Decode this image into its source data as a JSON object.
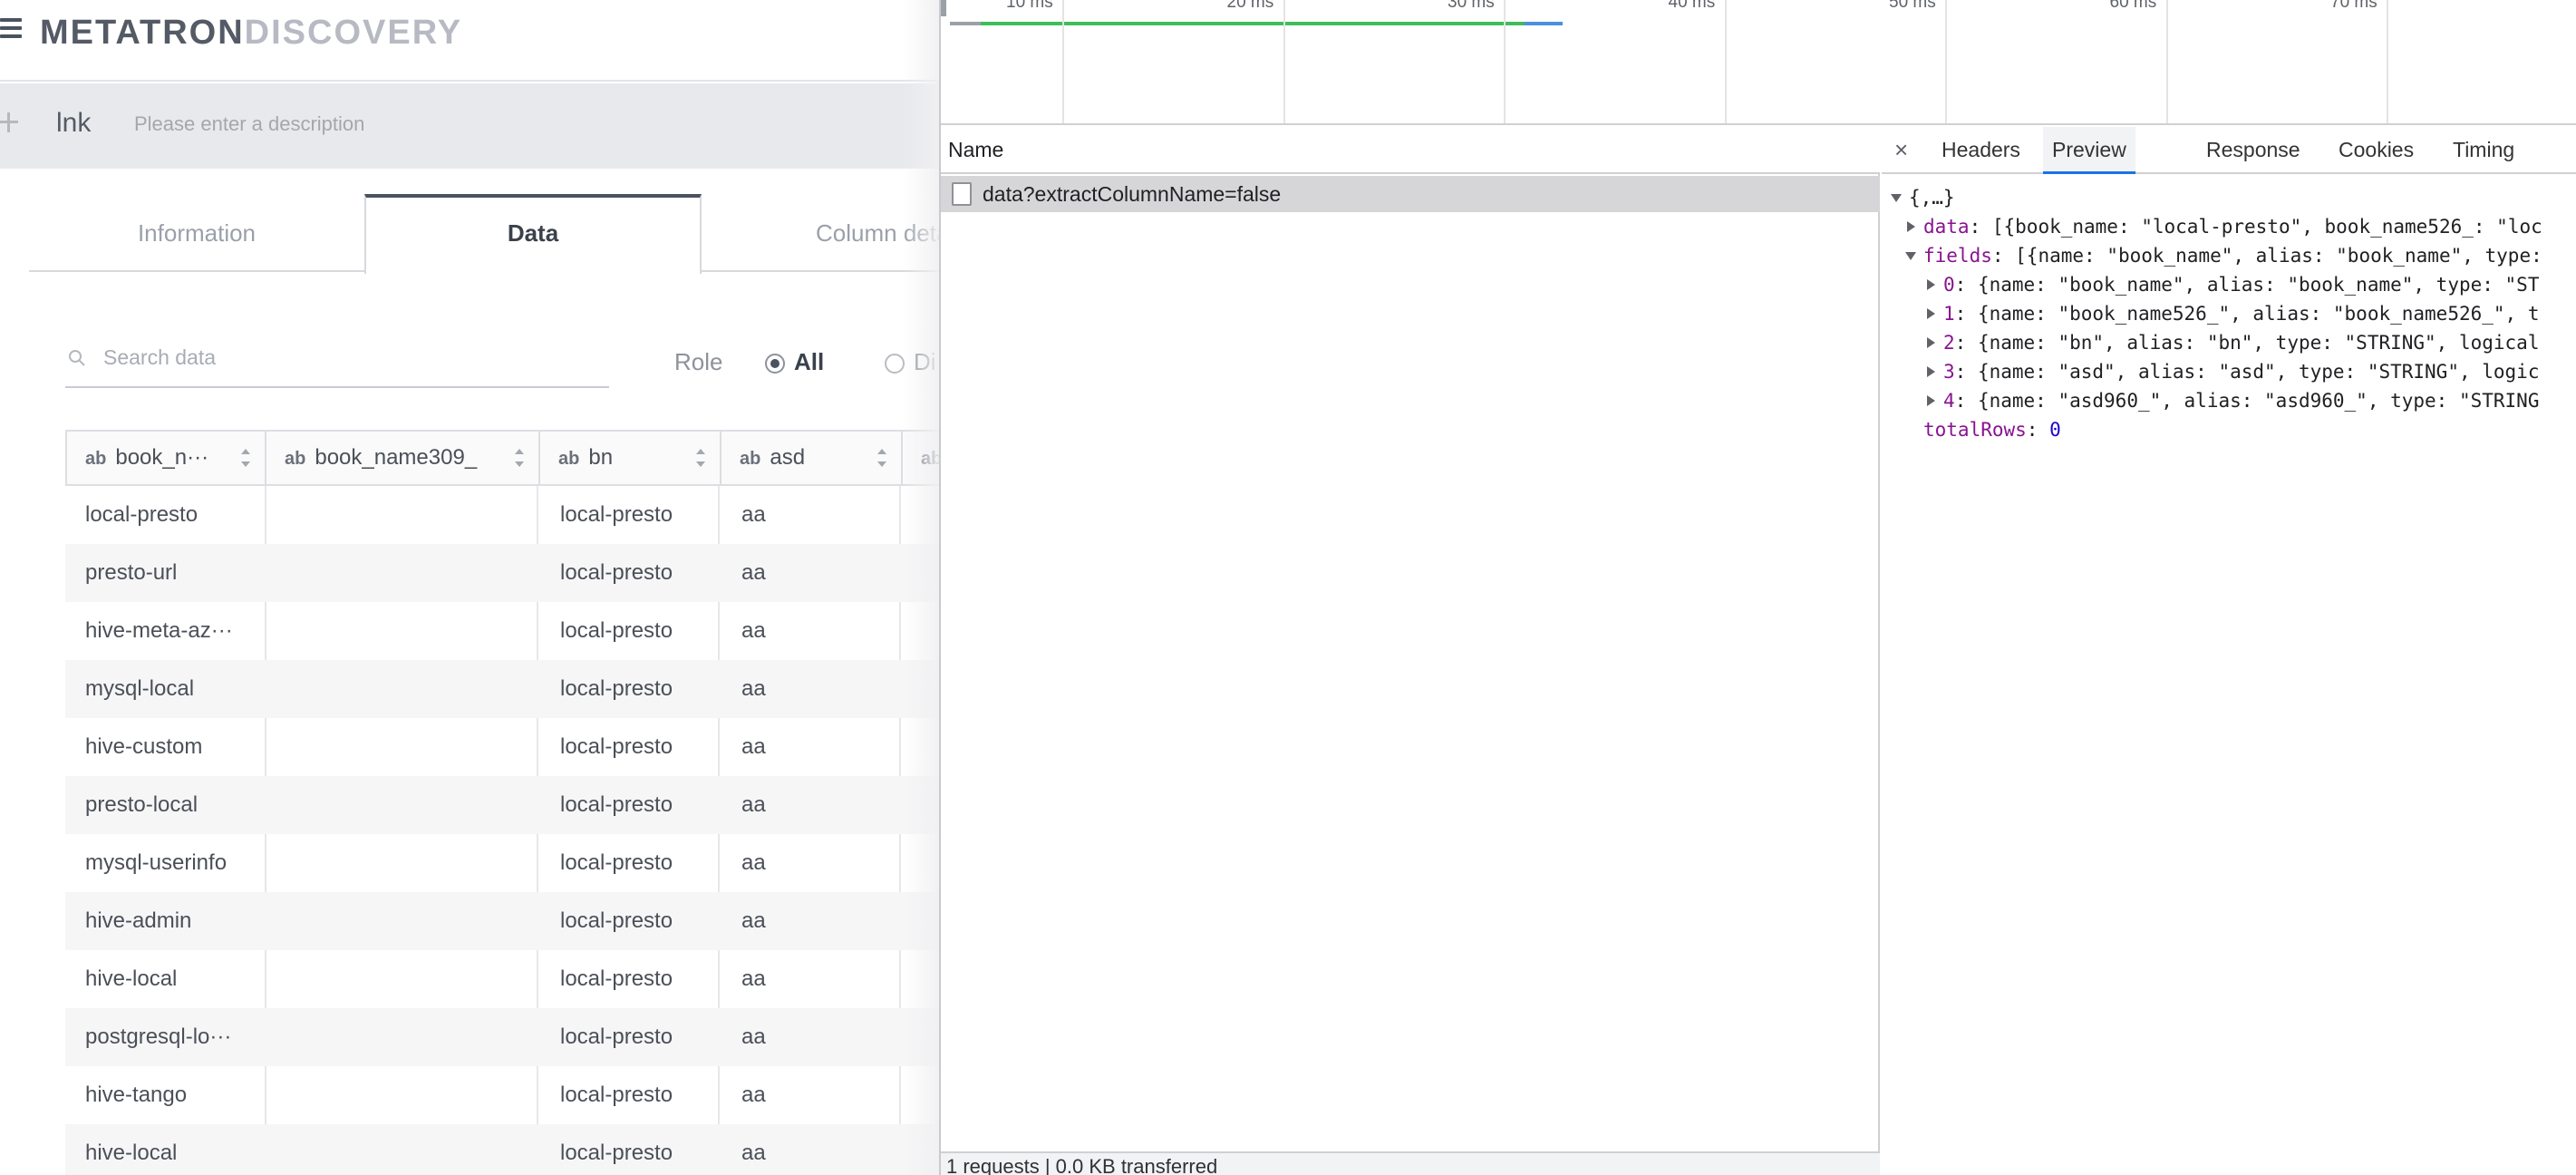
{
  "app": {
    "logo_part1": "METATRON",
    "logo_part2": "DISCOVERY",
    "datasource_name": "lnk",
    "description_placeholder": "Please enter a description",
    "tabs": [
      "Information",
      "Data",
      "Column detail"
    ],
    "search_placeholder": "Search data",
    "role_label": "Role",
    "role_options": [
      "All",
      "Di"
    ],
    "columns": [
      {
        "type": "ab",
        "name": "book_n···"
      },
      {
        "type": "ab",
        "name": "book_name309_"
      },
      {
        "type": "ab",
        "name": "bn"
      },
      {
        "type": "ab",
        "name": "asd"
      },
      {
        "type": "ab",
        "name": ""
      }
    ],
    "rows": [
      [
        "local-presto",
        "",
        "local-presto",
        "aa"
      ],
      [
        "presto-url",
        "",
        "local-presto",
        "aa"
      ],
      [
        "hive-meta-az···",
        "",
        "local-presto",
        "aa"
      ],
      [
        "mysql-local",
        "",
        "local-presto",
        "aa"
      ],
      [
        "hive-custom",
        "",
        "local-presto",
        "aa"
      ],
      [
        "presto-local",
        "",
        "local-presto",
        "aa"
      ],
      [
        "mysql-userinfo",
        "",
        "local-presto",
        "aa"
      ],
      [
        "hive-admin",
        "",
        "local-presto",
        "aa"
      ],
      [
        "hive-local",
        "",
        "local-presto",
        "aa"
      ],
      [
        "postgresql-lo···",
        "",
        "local-presto",
        "aa"
      ],
      [
        "hive-tango",
        "",
        "local-presto",
        "aa"
      ],
      [
        "hive-local",
        "",
        "local-presto",
        "aa"
      ]
    ]
  },
  "devtools": {
    "timeline_ticks": [
      "10 ms",
      "20 ms",
      "30 ms",
      "40 ms",
      "50 ms",
      "60 ms",
      "70 ms"
    ],
    "name_header": "Name",
    "request_name": "data?extractColumnName=false",
    "status": "1 requests | 0.0 KB transferred",
    "close_label": "×",
    "tabs": [
      "Headers",
      "Preview",
      "Response",
      "Cookies",
      "Timing"
    ],
    "preview": {
      "root": "{,…}",
      "data_key": "data",
      "data_value": "[{book_name: \"local-presto\", book_name526_: \"loc",
      "fields_key": "fields",
      "fields_value": "[{name: \"book_name\", alias: \"book_name\", type:",
      "fields": [
        {
          "index": "0",
          "value": "{name: \"book_name\", alias: \"book_name\", type: \"ST"
        },
        {
          "index": "1",
          "value": "{name: \"book_name526_\", alias: \"book_name526_\", t"
        },
        {
          "index": "2",
          "value": "{name: \"bn\", alias: \"bn\", type: \"STRING\", logical"
        },
        {
          "index": "3",
          "value": "{name: \"asd\", alias: \"asd\", type: \"STRING\", logic"
        },
        {
          "index": "4",
          "value": "{name: \"asd960_\", alias: \"asd960_\", type: \"STRING"
        }
      ],
      "total_rows_key": "totalRows",
      "total_rows_value": "0"
    }
  }
}
